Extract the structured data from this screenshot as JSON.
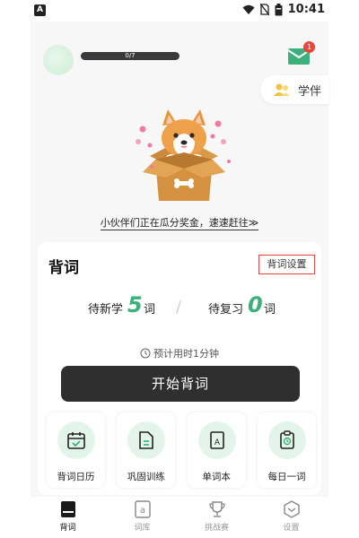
{
  "status_bar": {
    "left_icon": "A",
    "time": "10:41",
    "icons": [
      "wifi-icon",
      "no-sim-icon",
      "battery-icon"
    ]
  },
  "header": {
    "progress_text": "0/7",
    "mail_badge": "1",
    "companion_label": "学伴"
  },
  "promo": {
    "text": "小伙伴们正在瓜分奖金，速速赶往≫"
  },
  "card": {
    "title": "背词",
    "settings_label": "背词设置",
    "new_label": "待新学",
    "new_count": "5",
    "review_label": "待复习",
    "review_count": "0",
    "unit": "词",
    "separator": "/",
    "eta": "预计用时1分钟",
    "start_label": "开始背词",
    "features": [
      {
        "label": "背词日历",
        "icon": "calendar-check-icon"
      },
      {
        "label": "巩固训练",
        "icon": "document-icon"
      },
      {
        "label": "单词本",
        "icon": "wordbook-icon"
      },
      {
        "label": "每日一词",
        "icon": "daily-word-icon"
      }
    ]
  },
  "tabs": [
    {
      "label": "背词",
      "icon": "book-icon",
      "active": true
    },
    {
      "label": "词库",
      "icon": "word-library-icon",
      "active": false
    },
    {
      "label": "挑战赛",
      "icon": "trophy-icon",
      "active": false
    },
    {
      "label": "设置",
      "icon": "settings-icon",
      "active": false
    }
  ],
  "colors": {
    "accent_green": "#3bb07a",
    "button_dark": "#2f2f2f",
    "highlight_red": "#e0463f"
  }
}
